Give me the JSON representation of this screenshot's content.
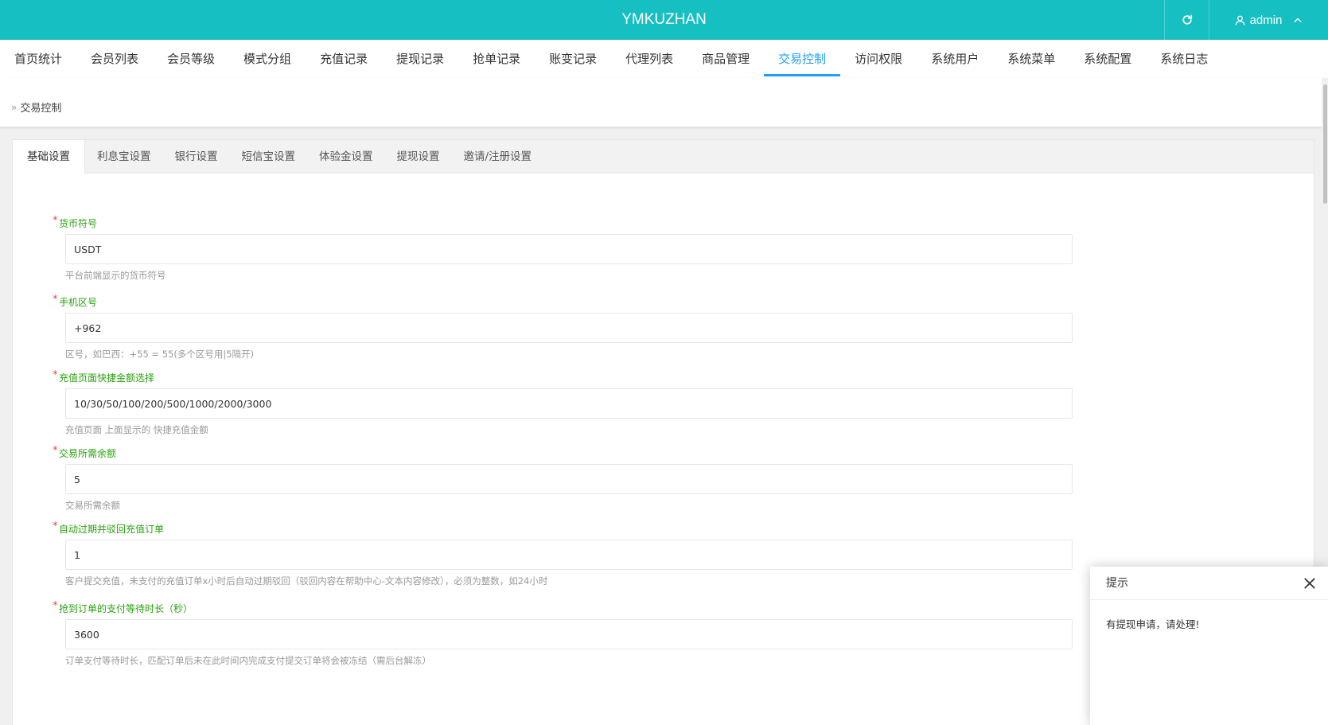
{
  "header": {
    "brand": "YMKUZHAN",
    "user": "admin",
    "accent_color": "#16bfc2"
  },
  "nav": {
    "items": [
      {
        "label": "首页统计",
        "active": false
      },
      {
        "label": "会员列表",
        "active": false
      },
      {
        "label": "会员等级",
        "active": false
      },
      {
        "label": "模式分组",
        "active": false
      },
      {
        "label": "充值记录",
        "active": false
      },
      {
        "label": "提现记录",
        "active": false
      },
      {
        "label": "抢单记录",
        "active": false
      },
      {
        "label": "账变记录",
        "active": false
      },
      {
        "label": "代理列表",
        "active": false
      },
      {
        "label": "商品管理",
        "active": false
      },
      {
        "label": "交易控制",
        "active": true
      },
      {
        "label": "访问权限",
        "active": false
      },
      {
        "label": "系统用户",
        "active": false
      },
      {
        "label": "系统菜单",
        "active": false
      },
      {
        "label": "系统配置",
        "active": false
      },
      {
        "label": "系统日志",
        "active": false
      }
    ],
    "active_color": "#1e9fff"
  },
  "breadcrumb": {
    "current": "交易控制"
  },
  "tabs": [
    {
      "label": "基础设置",
      "active": true
    },
    {
      "label": "利息宝设置",
      "active": false
    },
    {
      "label": "银行设置",
      "active": false
    },
    {
      "label": "短信宝设置",
      "active": false
    },
    {
      "label": "体验金设置",
      "active": false
    },
    {
      "label": "提现设置",
      "active": false
    },
    {
      "label": "邀请/注册设置",
      "active": false
    }
  ],
  "form": {
    "fields": [
      {
        "label": "货币符号",
        "value": "USDT",
        "help": "平台前端显示的货币符号"
      },
      {
        "label": "手机区号",
        "value": "+962",
        "help": "区号，如巴西：+55 = 55(多个区号用|5隔开)"
      },
      {
        "label": "充值页面快捷金额选择",
        "value": "10/30/50/100/200/500/1000/2000/3000",
        "help": "充值页面 上面显示的 快捷充值金额"
      },
      {
        "label": "交易所需余额",
        "value": "5",
        "help": "交易所需余额"
      },
      {
        "label": "自动过期并驳回充值订单",
        "value": "1",
        "help": "客户提交充值，未支付的充值订单x小时后自动过期驳回（驳回内容在帮助中心-文本内容修改），必须为整数，如24小时"
      },
      {
        "label": "抢到订单的支付等待时长（秒）",
        "value": "3600",
        "help": "订单支付等待时长，匹配订单后未在此时间内完成支付提交订单将会被冻结（需后台解冻）"
      }
    ],
    "label_color": "#2aa10f",
    "required_mark": "*"
  },
  "toast": {
    "title": "提示",
    "message": "有提现申请，请处理!"
  }
}
